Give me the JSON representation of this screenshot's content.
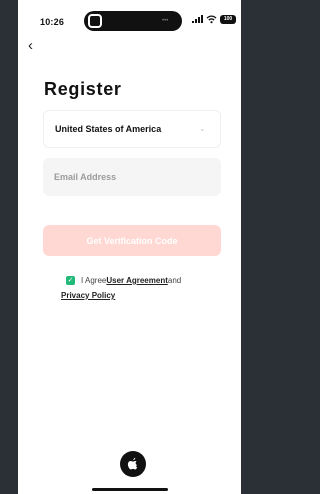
{
  "status_bar": {
    "time": "10:26",
    "battery": "100"
  },
  "navigation": {
    "back_icon": "‹"
  },
  "page": {
    "title": "Register"
  },
  "country_select": {
    "value": "United States of America",
    "icon": "chevron-down-icon"
  },
  "email": {
    "placeholder": "Email Address",
    "value": ""
  },
  "verification": {
    "label": "Get Verification Code",
    "color": "#ffd8d3"
  },
  "agreement": {
    "prefix": "I Agree",
    "user_agreement": "User Agreement",
    "conjunction": "and",
    "privacy_policy": "Privacy Policy",
    "checked": true,
    "checkbox_color": "#21b978"
  },
  "social_login": {
    "icon": "apple-icon"
  },
  "theme": {
    "background": "#2b2f36",
    "surface": "#ffffff"
  }
}
